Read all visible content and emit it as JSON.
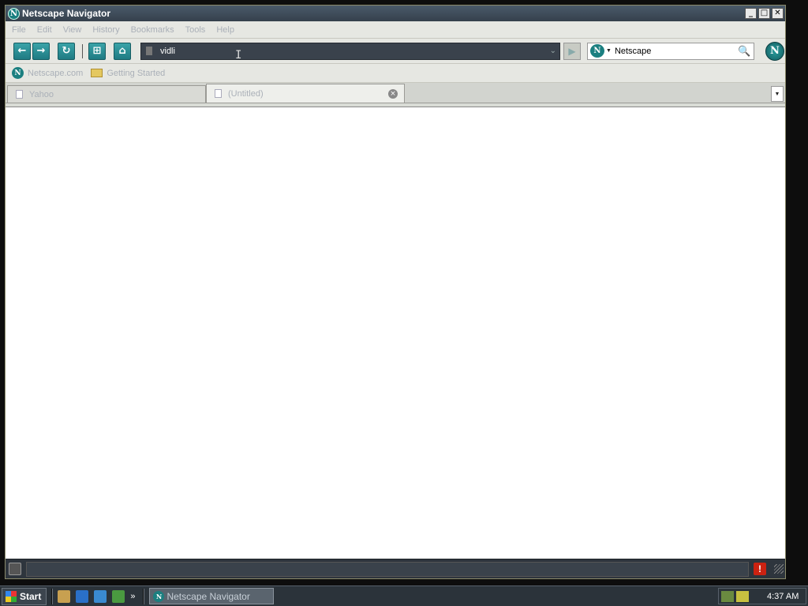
{
  "window": {
    "title": "Netscape Navigator",
    "logo_glyph": "N",
    "controls": {
      "minimize": "_",
      "maximize": "□",
      "close": "✕"
    }
  },
  "menubar": {
    "items": [
      "File",
      "Edit",
      "View",
      "History",
      "Bookmarks",
      "Tools",
      "Help"
    ]
  },
  "navbar": {
    "back_icon": "←",
    "forward_icon": "→",
    "reload_icon": "↻",
    "newtab_icon": "⊞",
    "home_icon": "⌂",
    "url_value": "vidli",
    "url_dropdown_icon": "⌄",
    "go_icon": "▶",
    "search_engine_glyph": "N",
    "search_engine_dropdown": "▼",
    "search_value": "Netscape",
    "search_icon": "🔍",
    "throbber_glyph": "N"
  },
  "bookmarks": {
    "items": [
      {
        "label": "Netscape.com",
        "icon": "netscape-icon"
      },
      {
        "label": "Getting Started",
        "icon": "folder-icon"
      }
    ]
  },
  "tabs": {
    "items": [
      {
        "label": "Yahoo",
        "active": false
      },
      {
        "label": "(Untitled)",
        "active": true
      }
    ],
    "close_glyph": "×",
    "list_glyph": "▼"
  },
  "statusbar": {
    "text": "",
    "alert_glyph": "!"
  },
  "taskbar": {
    "start_label": "Start",
    "quicklaunch_more": "»",
    "task_label": "Netscape Navigator",
    "clock": "4:37 AM"
  },
  "colors": {
    "accent_teal": "#1b7f80",
    "titlebar": "#3f4b57",
    "alert": "#cc2211"
  }
}
